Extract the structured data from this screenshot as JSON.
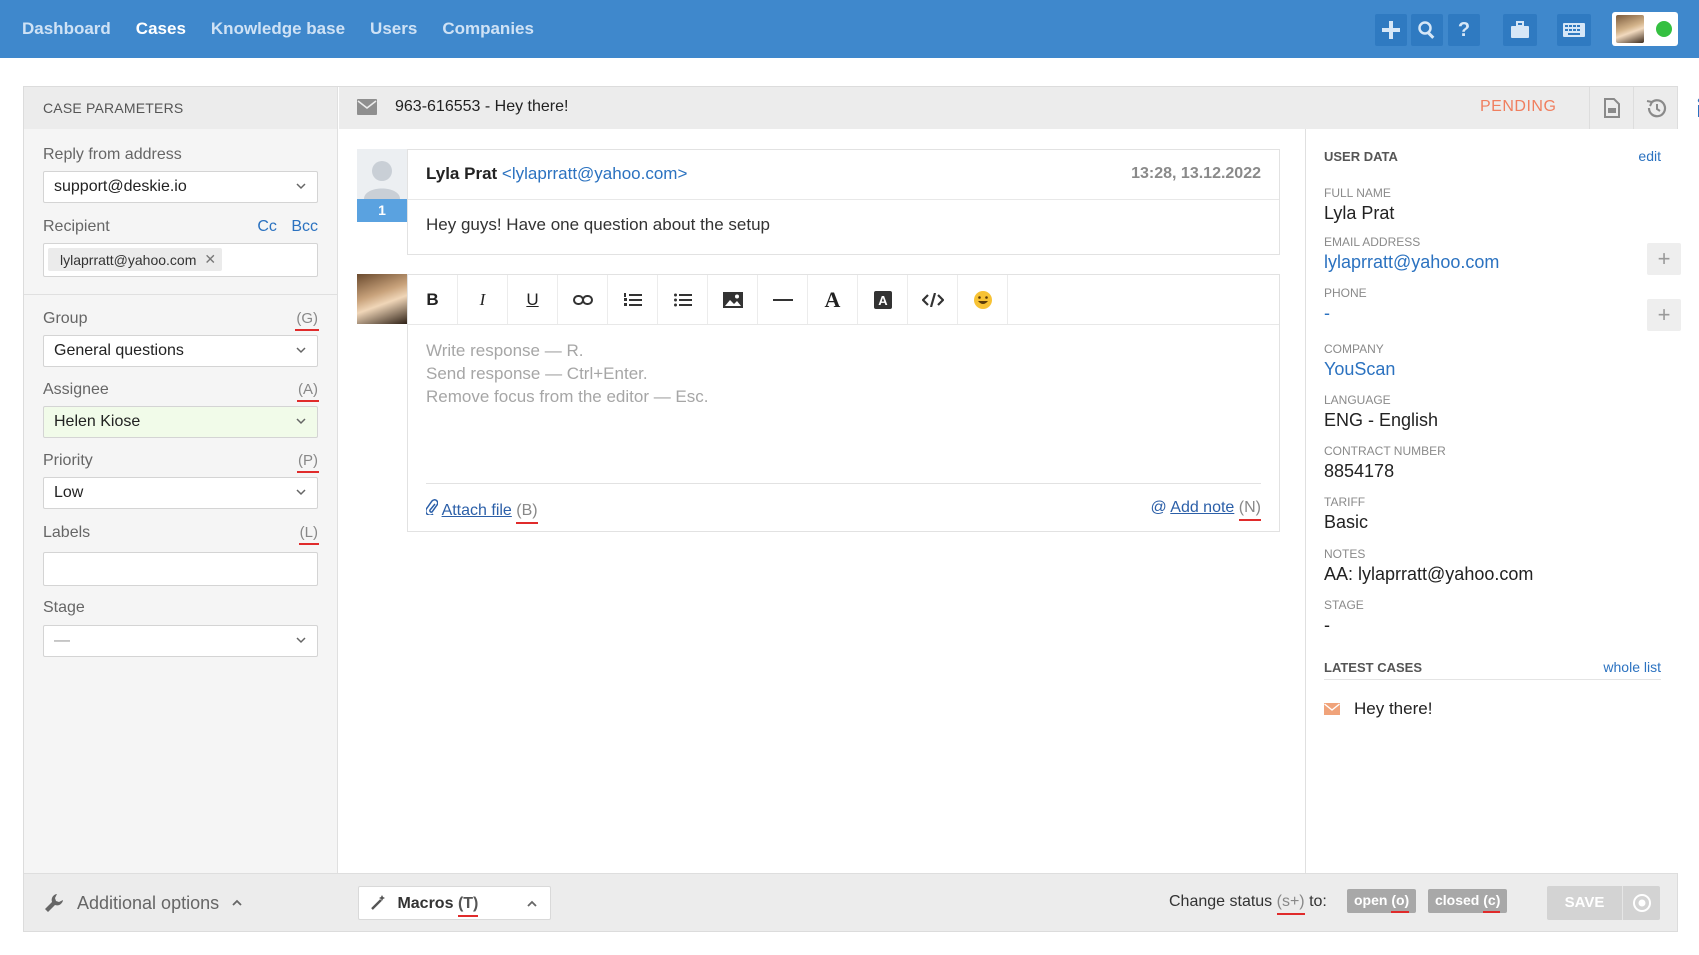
{
  "nav": {
    "items": [
      {
        "label": "Dashboard"
      },
      {
        "label": "Cases"
      },
      {
        "label": "Knowledge base"
      },
      {
        "label": "Users"
      },
      {
        "label": "Companies"
      }
    ],
    "active": "Cases"
  },
  "case_params": {
    "title": "CASE PARAMETERS",
    "reply_from_label": "Reply from address",
    "reply_from_value": "support@deskie.io",
    "recipient_label": "Recipient",
    "cc": "Cc",
    "bcc": "Bcc",
    "recipient_chip": "lylaprratt@yahoo.com",
    "group_label": "Group",
    "group_shortcut": "(G)",
    "group_value": "General questions",
    "assignee_label": "Assignee",
    "assignee_shortcut": "(A)",
    "assignee_value": "Helen Kiose",
    "priority_label": "Priority",
    "priority_shortcut": "(P)",
    "priority_value": "Low",
    "labels_label": "Labels",
    "labels_shortcut": "(L)",
    "stage_label": "Stage",
    "stage_value": "—"
  },
  "case": {
    "subject": "963-616553 - Hey there!",
    "status": "PENDING"
  },
  "message": {
    "author": "Lyla Prat",
    "email": "<lylaprratt@yahoo.com>",
    "time": "13:28, 13.12.2022",
    "number": "1",
    "body": "Hey guys! Have one question about the setup"
  },
  "editor": {
    "toolbar": [
      "bold",
      "italic",
      "underline",
      "link",
      "numbered-list",
      "bullet-list",
      "image",
      "horizontal-rule",
      "font-color",
      "background-color",
      "code",
      "emoji"
    ],
    "placeholder_1": "Write response — R.",
    "placeholder_2": "Send response — Ctrl+Enter.",
    "placeholder_3": "Remove focus from the editor — Esc.",
    "attach_label": "Attach file",
    "attach_shortcut": "(B)",
    "note_label": "Add note",
    "note_shortcut": "(N)"
  },
  "user_data": {
    "title": "USER DATA",
    "edit": "edit",
    "full_name_label": "FULL NAME",
    "full_name": "Lyla Prat",
    "email_label": "EMAIL ADDRESS",
    "email": "lylaprratt@yahoo.com",
    "phone_label": "PHONE",
    "phone": "-",
    "company_label": "COMPANY",
    "company": "YouScan",
    "language_label": "LANGUAGE",
    "language": "ENG - English",
    "contract_label": "CONTRACT NUMBER",
    "contract": "8854178",
    "tariff_label": "TARIFF",
    "tariff": "Basic",
    "notes_label": "NOTES",
    "notes": "AA: lylaprratt@yahoo.com",
    "stage_label": "STAGE",
    "stage": "-"
  },
  "latest_cases": {
    "title": "LATEST CASES",
    "whole_list": "whole list",
    "items": [
      {
        "subject": "Hey there!"
      }
    ]
  },
  "footer": {
    "additional_options": "Additional options",
    "macros": "Macros",
    "macros_shortcut": "(T)",
    "change_status_pre": "Change status ",
    "change_status_shortcut": "(s+)",
    "change_status_post": " to:",
    "open_label": "open",
    "open_shortcut": "(o)",
    "closed_label": "closed",
    "closed_shortcut": "(c)",
    "save": "SAVE"
  },
  "colors": {
    "topbar": "#3f88cc",
    "status_pending": "#f07f5f",
    "link": "#2b72c0",
    "online": "#35c041",
    "shortcut_underline": "#e02b2b"
  }
}
